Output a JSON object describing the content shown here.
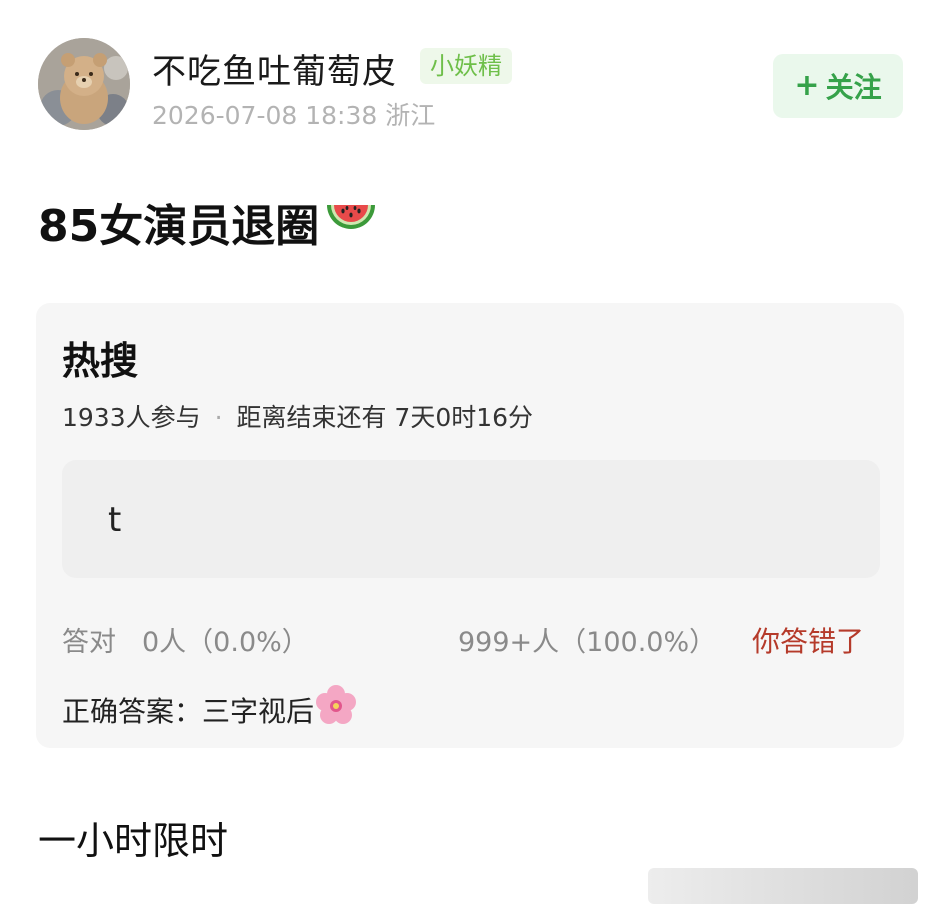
{
  "post": {
    "author": {
      "name": "不吃鱼吐葡萄皮",
      "badge": "小妖精"
    },
    "meta": "2026-07-08 18:38  浙江",
    "follow_label": "关注",
    "title": "85女演员退圈",
    "footer_text": "一小时限时"
  },
  "quiz": {
    "title": "热搜",
    "participants": "1933人参与",
    "separator": "·",
    "time_left": "距离结束还有 7天0时16分",
    "option_text": "t",
    "result_label": "答对",
    "correct_stat": "0人（0.0%）",
    "wrong_stat": "999+人（100.0%）",
    "status": "你答错了",
    "answer": "正确答案：三字视后"
  },
  "icons": {
    "follow": "plus-icon",
    "title_emoji": "watermelon-emoji",
    "answer_emoji": "cherry-blossom-emoji"
  },
  "colors": {
    "badge_green": "#6fbf4a",
    "follow_green": "#36a24a",
    "wrong_red": "#b53a2a"
  }
}
